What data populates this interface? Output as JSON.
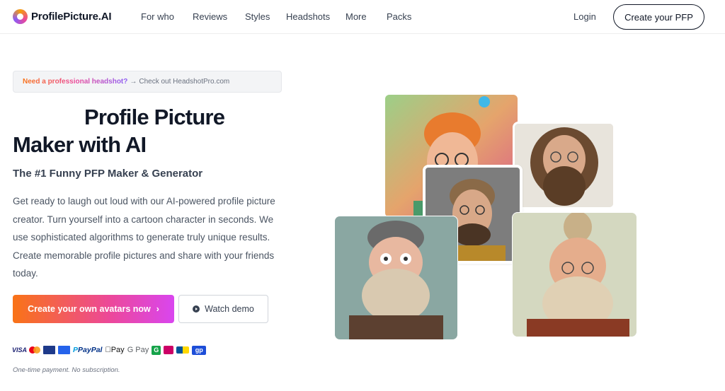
{
  "brand": {
    "name": "ProfilePicture.AI"
  },
  "nav": {
    "items": [
      "For who",
      "Reviews",
      "Styles",
      "Headshots",
      "More",
      "Packs"
    ],
    "login": "Login",
    "cta": "Create your PFP"
  },
  "banner": {
    "strong": "Need a professional headshot?",
    "arrow": "→",
    "link": "Check out HeadshotPro.com"
  },
  "hero": {
    "title_line1": "Profile Picture",
    "title_line2": "Maker with AI",
    "subtitle": "The #1 Funny PFP Maker & Generator",
    "description": "Get ready to laugh out loud with our AI-powered profile picture creator. Turn yourself into a cartoon character in seconds. We use sophisticated algorithms to generate truly unique results. Create memorable profile pictures and share with your friends today.",
    "primary_button": "Create your own avatars now",
    "primary_chevron": "›",
    "secondary_button": "Watch demo"
  },
  "payments": {
    "visa": "VISA",
    "paypal_p": "P",
    "paypal": "PayPal",
    "apple_pay": "Pay",
    "google_pay": "G Pay",
    "green": "G",
    "gp": "gp",
    "note": "One-time payment. No subscription."
  },
  "colors": {
    "gradient_start": "#f97316",
    "gradient_end": "#d946ef",
    "text_dark": "#111827"
  }
}
